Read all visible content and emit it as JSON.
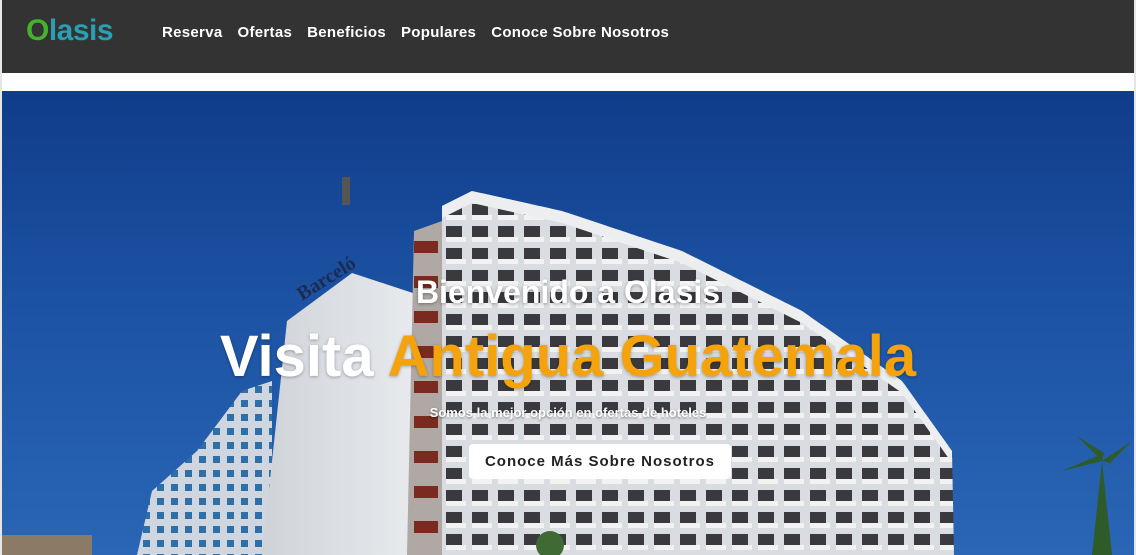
{
  "brand": {
    "logo_first": "O",
    "logo_rest": "lasis",
    "color_green": "#46b12a",
    "color_teal": "#2a9fb3"
  },
  "nav": {
    "items": [
      {
        "label": "Reserva"
      },
      {
        "label": "Ofertas"
      },
      {
        "label": "Beneficios"
      },
      {
        "label": "Populares"
      },
      {
        "label": "Conoce Sobre Nosotros"
      }
    ]
  },
  "hero": {
    "welcome": "Bienvenido a Olasis",
    "headline_white": "Visita",
    "headline_accent": "Antigua Guatemala",
    "accent_color": "#f5a30c",
    "tagline": "Somos la mejor opción en ofertas de hoteles",
    "cta_label": "Conoce Más Sobre Nosotros",
    "background": "hotel-building-photo"
  }
}
